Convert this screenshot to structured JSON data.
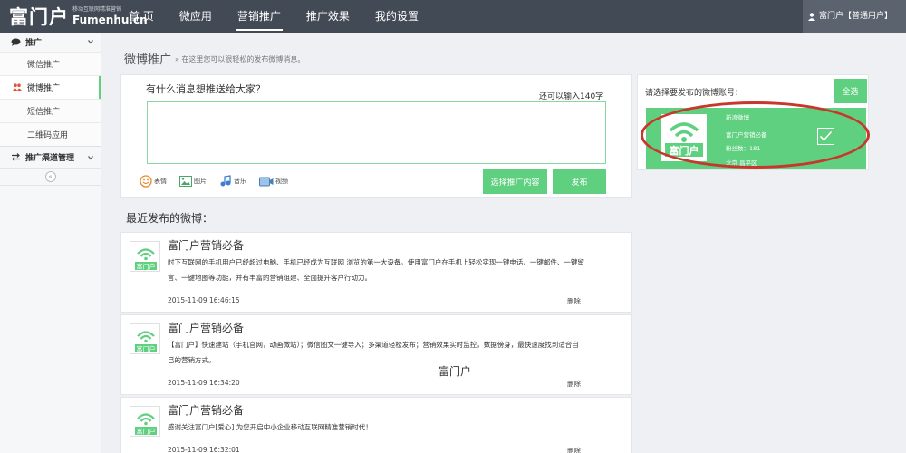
{
  "brand": {
    "name_cn": "富门户",
    "tagline": "移动互联网精准营销",
    "name_en": "Fumenhu.cn"
  },
  "nav": {
    "items": [
      "首 页",
      "微应用",
      "营销推广",
      "推广效果",
      "我的设置"
    ],
    "active": "营销推广"
  },
  "user": {
    "label": "富门户【普通用户】"
  },
  "sidebar": {
    "group1": "推广",
    "items": [
      "微信推广",
      "微博推广",
      "短信推广",
      "二维码应用"
    ],
    "active": "微博推广",
    "group2": "推广渠道管理"
  },
  "page": {
    "title": "微博推广",
    "hint": "» 在这里您可以很轻松的发布微博消息。"
  },
  "compose": {
    "question": "有什么消息想推送给大家？",
    "remaining": "还可以输入140字",
    "text": "",
    "tools": {
      "emoji": "表情",
      "image": "图片",
      "music": "音乐",
      "video": "视频"
    },
    "select_button": "选择推广内容",
    "publish_button": "发布"
  },
  "recent": {
    "title": "最近发布的微博：",
    "posts": [
      {
        "name": "富门户营销必备",
        "body": "时下互联网的手机用户已经超过电脑、手机已经成为互联网 浏览的第一大设备。使用富门户在手机上轻松实现一键电话、一键邮件、一键留言、一键地图等功能，并有丰富的营销组建、全面提升客户行动力。",
        "time": "2015-11-09 16:46:15",
        "delete": "删除"
      },
      {
        "name": "富门户营销必备",
        "body": "【富门户】快速建站（手机官网，动画微站）；微信图文一键导入；多渠道轻松发布；营销效果实时监控，数据傍身，最快速度找到适合自己的营销方式。",
        "time": "2015-11-09 16:34:20",
        "delete": "删除"
      },
      {
        "name": "富门户营销必备",
        "body": "感谢关注富门户[爱心] 为您开启中小企业移动互联网精准营销时代！",
        "time": "2015-11-09 16:32:01",
        "delete": "删除"
      }
    ]
  },
  "watermark": "富门户",
  "accounts": {
    "label": "请选择要发布的微博账号：",
    "select_all": "全选",
    "card": {
      "platform": "新浪微博",
      "name": "富门户营销必备",
      "fans": "粉丝数：181",
      "location": "北京 昌平区",
      "logo_text": "富门户",
      "checked": true
    }
  },
  "colors": {
    "topbar": "#424a55",
    "accent": "#5fcf80",
    "highlight": "#c8372b"
  }
}
